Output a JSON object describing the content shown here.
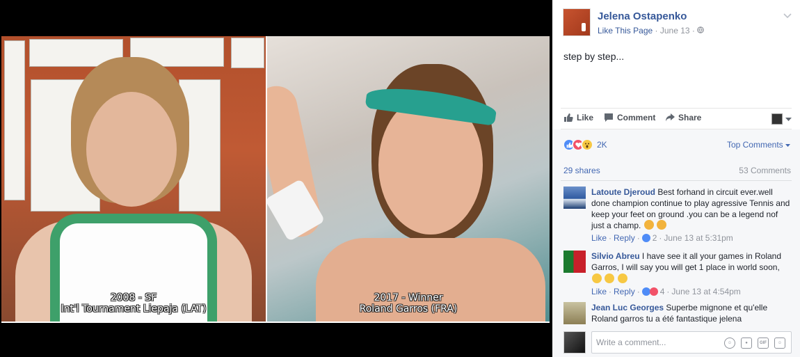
{
  "photo": {
    "left_caption_line1": "2008 - SF",
    "left_caption_line2": "Int'l Tournament Liepaja (LAT)",
    "right_caption_line1": "2017 - Winner",
    "right_caption_line2": "Roland Garros (FRA)"
  },
  "post": {
    "page_name": "Jelena Ostapenko",
    "like_page": "Like This Page",
    "separator": "·",
    "date": "June 13",
    "text": "step by step..."
  },
  "actions": {
    "like": "Like",
    "comment": "Comment",
    "share": "Share"
  },
  "feedback": {
    "reaction_count": "2K",
    "top_comments": "Top Comments",
    "shares": "29 shares",
    "comments": "53 Comments"
  },
  "comments": [
    {
      "name": "Latoute Djeroud",
      "text": "Best forhand in circuit ever.well done champion continue to play agressive Tennis and keep your feet on ground .you can be a legend nof just a champ.",
      "like": "Like",
      "reply": "Reply",
      "reactions": "2",
      "time": "June 13 at 5:31pm"
    },
    {
      "name": "Silvio Abreu",
      "text": "I have see it all your games in Roland Garros, I will say you will get 1 place in world soon,",
      "like": "Like",
      "reply": "Reply",
      "reactions": "4",
      "time": "June 13 at 4:54pm"
    },
    {
      "name": "Jean Luc Georges",
      "text": "Superbe mignone et qu'elle Roland garros tu a été fantastique jelena"
    }
  ],
  "composer": {
    "placeholder": "Write a comment..."
  },
  "colors": {
    "link": "#365899",
    "action_blue": "#4267b2",
    "muted": "#90949c"
  }
}
